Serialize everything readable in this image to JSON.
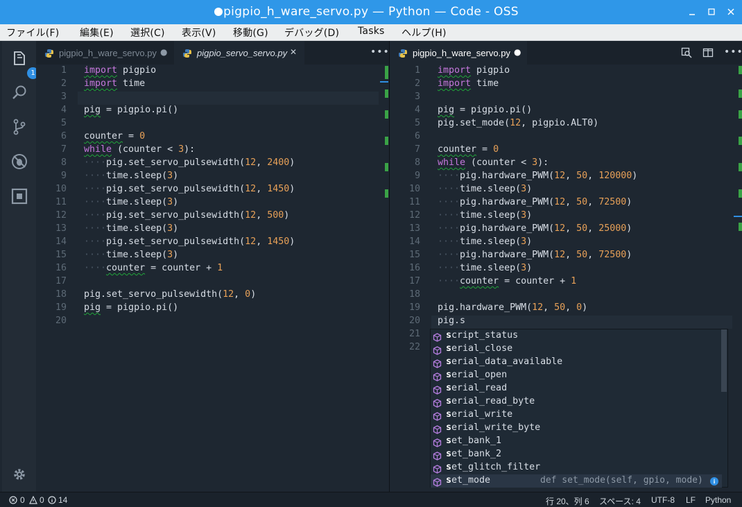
{
  "window": {
    "title": "pigpio_h_ware_servo.py — Python — Code - OSS"
  },
  "menu": [
    "ファイル(F)",
    "編集(E)",
    "選択(C)",
    "表示(V)",
    "移動(G)",
    "デバッグ(D)",
    "Tasks",
    "ヘルプ(H)"
  ],
  "activity": {
    "badge": "1"
  },
  "left_tabs": [
    {
      "label": "pigpio_h_ware_servo.py",
      "state": "dirty"
    },
    {
      "label": "pigpio_servo_servo.py",
      "state": "active-close"
    }
  ],
  "right_tabs": [
    {
      "label": "pigpio_h_ware_servo.py",
      "state": "dirty"
    }
  ],
  "left_editor": {
    "line_numbers": [
      "1",
      "2",
      "3",
      "4",
      "5",
      "6",
      "7",
      "8",
      "9",
      "10",
      "11",
      "12",
      "13",
      "14",
      "15",
      "16",
      "17",
      "18",
      "19",
      "20"
    ],
    "lines": [
      "import pigpio",
      "import time",
      "",
      "pig = pigpio.pi()",
      "",
      "counter = 0",
      "while (counter < 3):",
      "    pig.set_servo_pulsewidth(12, 2400)",
      "    time.sleep(3)",
      "    pig.set_servo_pulsewidth(12, 1450)",
      "    time.sleep(3)",
      "    pig.set_servo_pulsewidth(12, 500)",
      "    time.sleep(3)",
      "    pig.set_servo_pulsewidth(12, 1450)",
      "    time.sleep(3)",
      "    counter = counter + 1",
      "",
      "pig.set_servo_pulsewidth(12, 0)",
      "pig = pigpio.pi()",
      ""
    ]
  },
  "right_editor": {
    "line_numbers": [
      "1",
      "2",
      "3",
      "4",
      "5",
      "6",
      "7",
      "8",
      "9",
      "10",
      "11",
      "12",
      "13",
      "14",
      "15",
      "16",
      "17",
      "18",
      "19",
      "20",
      "21",
      "22"
    ],
    "lines": [
      "import pigpio",
      "import time",
      "",
      "pig = pigpio.pi()",
      "pig.set_mode(12, pigpio.ALT0)",
      "",
      "counter = 0",
      "while (counter < 3):",
      "    pig.hardware_PWM(12, 50, 120000)",
      "    time.sleep(3)",
      "    pig.hardware_PWM(12, 50, 72500)",
      "    time.sleep(3)",
      "    pig.hardware_PWM(12, 50, 25000)",
      "    time.sleep(3)",
      "    pig.hardware_PWM(12, 50, 72500)",
      "    time.sleep(3)",
      "    counter = counter + 1",
      "",
      "pig.hardware_PWM(12, 50, 0)",
      "pig.s",
      "",
      ""
    ]
  },
  "suggestions": {
    "items": [
      "script_status",
      "serial_close",
      "serial_data_available",
      "serial_open",
      "serial_read",
      "serial_read_byte",
      "serial_write",
      "serial_write_byte",
      "set_bank_1",
      "set_bank_2",
      "set_glitch_filter",
      "set_mode"
    ],
    "selected_detail": "def set_mode(self, gpio, mode)"
  },
  "statusbar": {
    "errors": "0",
    "warnings": "0",
    "infos": "14",
    "position": "行 20、列 6",
    "spaces": "スペース: 4",
    "encoding": "UTF-8",
    "eol": "LF",
    "language": "Python"
  },
  "colors": {
    "accent": "#2f97e8",
    "keyword": "#c678dd",
    "number": "#e8a158",
    "squiggle": "#21a43a",
    "gutter_add": "#3aa246"
  }
}
